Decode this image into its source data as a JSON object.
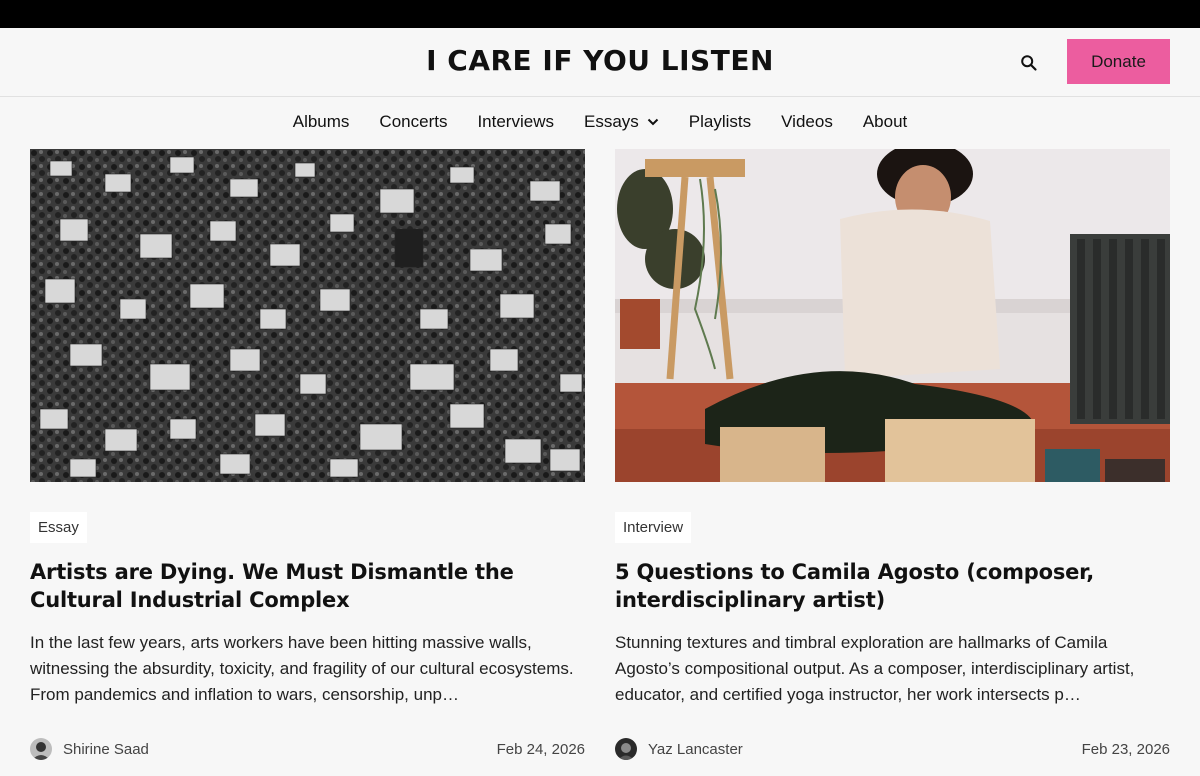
{
  "site": {
    "title": "I CARE IF YOU LISTEN",
    "donate_label": "Donate",
    "search_icon": "search-icon",
    "accent_color": "#ec5d9f"
  },
  "nav": {
    "items": [
      {
        "label": "Albums"
      },
      {
        "label": "Concerts"
      },
      {
        "label": "Interviews"
      },
      {
        "label": "Essays"
      },
      {
        "label": "Playlists"
      },
      {
        "label": "Videos"
      },
      {
        "label": "About"
      }
    ],
    "dropdown_icon": "chevron-down-icon"
  },
  "posts": [
    {
      "tag": "Essay",
      "title": "Artists are Dying. We Must Dismantle the Cultural Industrial Complex",
      "excerpt": "In the last few years, arts workers have been hitting massive walls, witnessing the absurdity, toxicity, and fragility of our cultural ecosystems. From pandemics and inflation to wars, censorship, unp…",
      "author": "Shirine Saad",
      "date": "Feb 24, 2026",
      "image": "black-and-white photo of a large protest crowd holding signs"
    },
    {
      "tag": "Interview",
      "title": "5 Questions to Camila Agosto (composer, interdisciplinary artist)",
      "excerpt": "Stunning textures and timbral exploration are hallmarks of Camila Agosto’s compositional output. As a composer, interdisciplinary artist, educator, and certified yoga instructor, her work intersects p…",
      "author": "Yaz Lancaster",
      "date": "Feb 23, 2026",
      "image": "woman sitting on a wooden floor unpacking cardboard boxes"
    }
  ]
}
